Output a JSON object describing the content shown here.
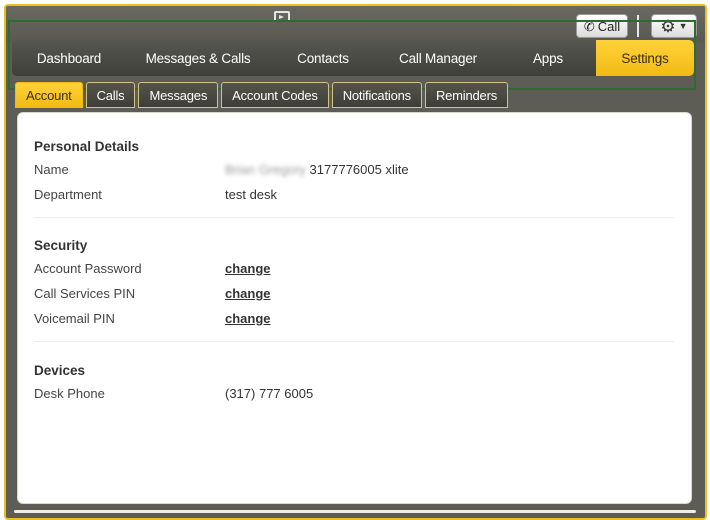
{
  "toolbar": {
    "call_label": "Call",
    "icons": {
      "video": "video-camera-icon",
      "phone": "phone-icon",
      "gear": "gear-icon",
      "caret": "caret-down-icon"
    }
  },
  "nav": {
    "items": [
      {
        "label": "Dashboard"
      },
      {
        "label": "Messages & Calls"
      },
      {
        "label": "Contacts"
      },
      {
        "label": "Call Manager"
      },
      {
        "label": "Apps"
      },
      {
        "label": "Settings"
      }
    ],
    "active": "Settings"
  },
  "subtabs": {
    "items": [
      {
        "label": "Account"
      },
      {
        "label": "Calls"
      },
      {
        "label": "Messages"
      },
      {
        "label": "Account Codes"
      },
      {
        "label": "Notifications"
      },
      {
        "label": "Reminders"
      }
    ],
    "active": "Account"
  },
  "account": {
    "personal": {
      "title": "Personal Details",
      "name_label": "Name",
      "name_blurred": "Brian Gregory",
      "name_value": "3177776005 xlite",
      "department_label": "Department",
      "department_value": "test desk"
    },
    "security": {
      "title": "Security",
      "account_password_label": "Account Password",
      "call_services_pin_label": "Call Services PIN",
      "voicemail_pin_label": "Voicemail PIN",
      "change_label": "change"
    },
    "devices": {
      "title": "Devices",
      "desk_phone_label": "Desk Phone",
      "desk_phone_value": "(317) 777 6005"
    }
  },
  "colors": {
    "accent": "#f2bb14",
    "nav_bg": "#4a4a44",
    "link": "#c49a12",
    "frame_border": "#e8c024",
    "highlight_box": "#2d6b30"
  }
}
